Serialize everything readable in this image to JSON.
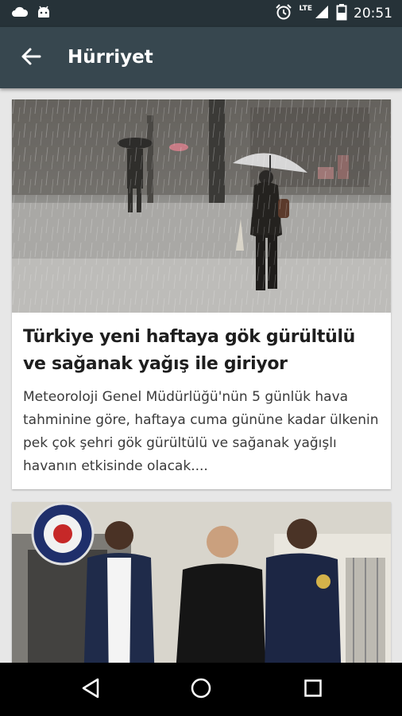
{
  "status_bar": {
    "time": "20:51",
    "network": "LTE",
    "icons": [
      "cloud-icon",
      "android-icon",
      "alarm-icon",
      "signal-icon",
      "battery-icon"
    ]
  },
  "app_bar": {
    "title": "Hürriyet",
    "back_icon": "arrow-left-icon"
  },
  "articles": [
    {
      "image": "rain-umbrella-photo",
      "title": "Türkiye yeni haftaya gök gürültülü ve sağanak yağış ile giriyor",
      "summary": "Meteoroloji Genel Müdürlüğü'nün 5 günlük hava tahminine göre, haftaya cuma gününe kadar ülkenin pek çok şehri gök gürültülü ve sağanak yağışlı havanın etkisinde olacak...."
    },
    {
      "image": "police-officers-photo",
      "title": "",
      "summary": ""
    }
  ],
  "nav_bar": {
    "icons": [
      "back-triangle-icon",
      "home-circle-icon",
      "recents-square-icon"
    ]
  },
  "colors": {
    "status_bar": "#263238",
    "app_bar": "#37474f",
    "background": "#e7e7e7"
  }
}
